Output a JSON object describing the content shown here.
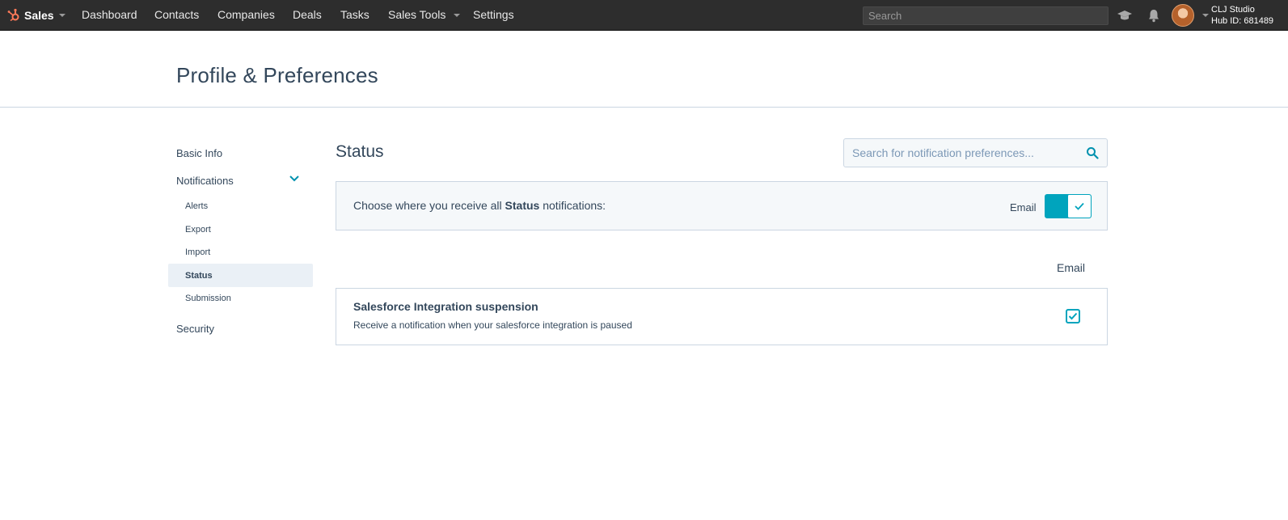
{
  "topbar": {
    "brand": "Sales",
    "nav": [
      "Dashboard",
      "Contacts",
      "Companies",
      "Deals",
      "Tasks",
      "Sales Tools",
      "Settings"
    ],
    "search_placeholder": "Search",
    "account_name": "CLJ Studio",
    "hub_id": "Hub ID: 681489",
    "colors": {
      "bar": "#2d2d2d",
      "brand_accent": "#ff7a59"
    }
  },
  "page": {
    "title": "Profile & Preferences"
  },
  "sidebar": {
    "basic_info": "Basic Info",
    "notifications": "Notifications",
    "sub_items": [
      "Alerts",
      "Export",
      "Import",
      "Status",
      "Submission"
    ],
    "active": "Status",
    "security": "Security"
  },
  "main": {
    "section_title": "Status",
    "search_placeholder": "Search for notification preferences...",
    "all_prefix": "Choose where you receive all ",
    "all_bold": "Status",
    "all_suffix": " notifications:",
    "toggle_label": "Email",
    "toggle_on": true,
    "column_header": "Email",
    "rows": [
      {
        "title": "Salesforce Integration suspension",
        "description": "Receive a notification when your salesforce integration is paused",
        "email_checked": true
      }
    ],
    "accent_color": "#00a4bd"
  }
}
